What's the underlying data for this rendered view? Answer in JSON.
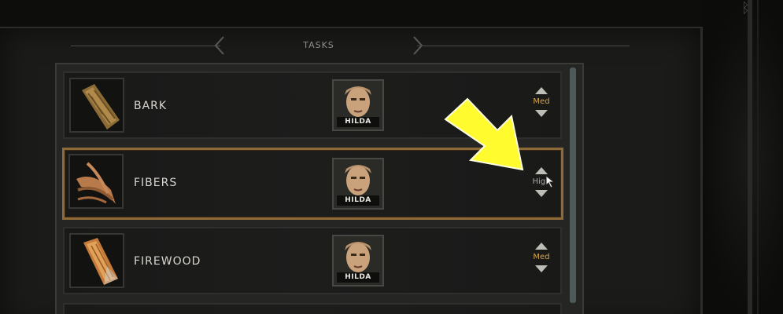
{
  "panel": {
    "title": "TASKS"
  },
  "tasks": [
    {
      "name": "BARK",
      "worker": "HILDA",
      "priority": "Med",
      "icon": "bark-icon"
    },
    {
      "name": "FIBERS",
      "worker": "HILDA",
      "priority": "High",
      "icon": "fibers-icon"
    },
    {
      "name": "FIREWOOD",
      "worker": "HILDA",
      "priority": "Med",
      "icon": "firewood-icon"
    }
  ],
  "colors": {
    "selected_border": "#8d6a37",
    "priority_text": "#d3a650",
    "arrow": "#fffb2e"
  },
  "icons": {
    "priority_up": "triangle-up-icon",
    "priority_down": "triangle-down-icon",
    "header_left": "chevron-left-icon",
    "header_right": "chevron-right-icon",
    "overlay": "yellow-arrow-icon",
    "pointer": "cursor-icon"
  }
}
